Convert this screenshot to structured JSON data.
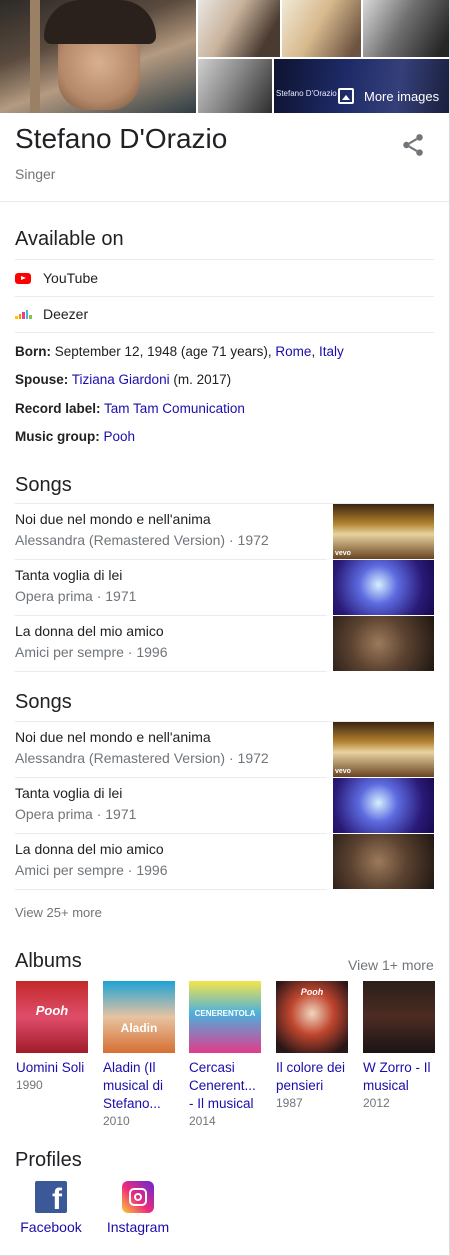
{
  "photos": {
    "overlay_caption": "Stefano D'Orazio",
    "more_images_label": "More images"
  },
  "entity": {
    "name": "Stefano D'Orazio",
    "type": "Singer"
  },
  "available_on": {
    "heading": "Available on",
    "items": [
      {
        "label": "YouTube",
        "icon": "youtube-icon"
      },
      {
        "label": "Deezer",
        "icon": "deezer-icon"
      }
    ]
  },
  "facts": {
    "born": {
      "label": "Born:",
      "text": "September 12, 1948 (age 71 years),",
      "link1": "Rome",
      "sep": ",",
      "link2": "Italy"
    },
    "spouse": {
      "label": "Spouse:",
      "link": "Tiziana Giardoni",
      "text": "(m. 2017)"
    },
    "record_label": {
      "label": "Record label:",
      "link": "Tam Tam Comunication"
    },
    "music_group": {
      "label": "Music group:",
      "link": "Pooh"
    }
  },
  "songs_sections": [
    {
      "heading": "Songs",
      "items": [
        {
          "title": "Noi due nel mondo e nell'anima",
          "meta": "Alessandra (Remastered Version) · 1972",
          "thumb_caption": "vevo"
        },
        {
          "title": "Tanta voglia di lei",
          "meta": "Opera prima · 1971"
        },
        {
          "title": "La donna del mio amico",
          "meta": "Amici per sempre · 1996"
        }
      ]
    },
    {
      "heading": "Songs",
      "items": [
        {
          "title": "Noi due nel mondo e nell'anima",
          "meta": "Alessandra (Remastered Version) · 1972",
          "thumb_caption": "vevo"
        },
        {
          "title": "Tanta voglia di lei",
          "meta": "Opera prima · 1971"
        },
        {
          "title": "La donna del mio amico",
          "meta": "Amici per sempre · 1996"
        }
      ]
    }
  ],
  "view_more_songs": "View 25+ more",
  "albums": {
    "heading": "Albums",
    "view_more": "View 1+ more",
    "items": [
      {
        "title_lines": [
          "Uomini Soli"
        ],
        "year": "1990",
        "cover_text": "Pooh"
      },
      {
        "title_lines": [
          "Aladin (Il",
          "musical di",
          "Stefano..."
        ],
        "year": "2010",
        "cover_text": "Aladin"
      },
      {
        "title_lines": [
          "Cercasi",
          "Cenerent...",
          "- Il musical"
        ],
        "year": "2014",
        "cover_text": "CENERENTOLA"
      },
      {
        "title_lines": [
          "Il colore dei",
          "pensieri"
        ],
        "year": "1987",
        "cover_text": "Pooh"
      },
      {
        "title_lines": [
          "W Zorro - Il",
          "musical"
        ],
        "year": "2012",
        "cover_text": ""
      }
    ]
  },
  "profiles": {
    "heading": "Profiles",
    "items": [
      {
        "label": "Facebook",
        "icon": "facebook-icon"
      },
      {
        "label": "Instagram",
        "icon": "instagram-icon"
      }
    ]
  }
}
